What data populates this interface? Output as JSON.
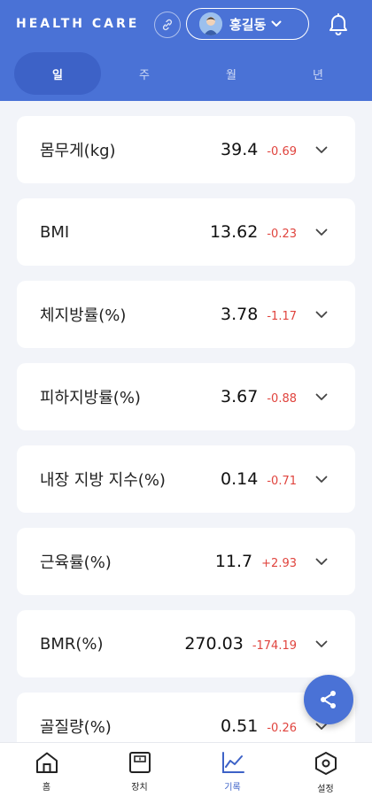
{
  "header": {
    "brand": "HEALTH CARE",
    "user_name": "홍길동",
    "accent": "#4a72d6"
  },
  "tabs": [
    {
      "label": "일",
      "active": true
    },
    {
      "label": "주",
      "active": false
    },
    {
      "label": "월",
      "active": false
    },
    {
      "label": "년",
      "active": false
    }
  ],
  "metrics": [
    {
      "label": "몸무게(kg)",
      "value": "39.4",
      "delta": "-0.69"
    },
    {
      "label": "BMI",
      "value": "13.62",
      "delta": "-0.23"
    },
    {
      "label": "체지방률(%)",
      "value": "3.78",
      "delta": "-1.17"
    },
    {
      "label": "피하지방률(%)",
      "value": "3.67",
      "delta": "-0.88"
    },
    {
      "label": "내장 지방 지수(%)",
      "value": "0.14",
      "delta": "-0.71"
    },
    {
      "label": "근육률(%)",
      "value": "11.7",
      "delta": "+2.93"
    },
    {
      "label": "BMR(%)",
      "value": "270.03",
      "delta": "-174.19"
    },
    {
      "label": "골질량(%)",
      "value": "0.51",
      "delta": "-0.26"
    }
  ],
  "bottom_nav": [
    {
      "label": "홈",
      "icon": "home-icon",
      "active": false
    },
    {
      "label": "장치",
      "icon": "scale-icon",
      "active": false
    },
    {
      "label": "기록",
      "icon": "chart-line-icon",
      "active": true
    },
    {
      "label": "설정",
      "icon": "hexagon-settings-icon",
      "active": false
    }
  ],
  "colors": {
    "accent": "#4a72d6",
    "tab_active": "#3d62c7",
    "delta": "#e0443e",
    "background": "#f2f4f9"
  }
}
